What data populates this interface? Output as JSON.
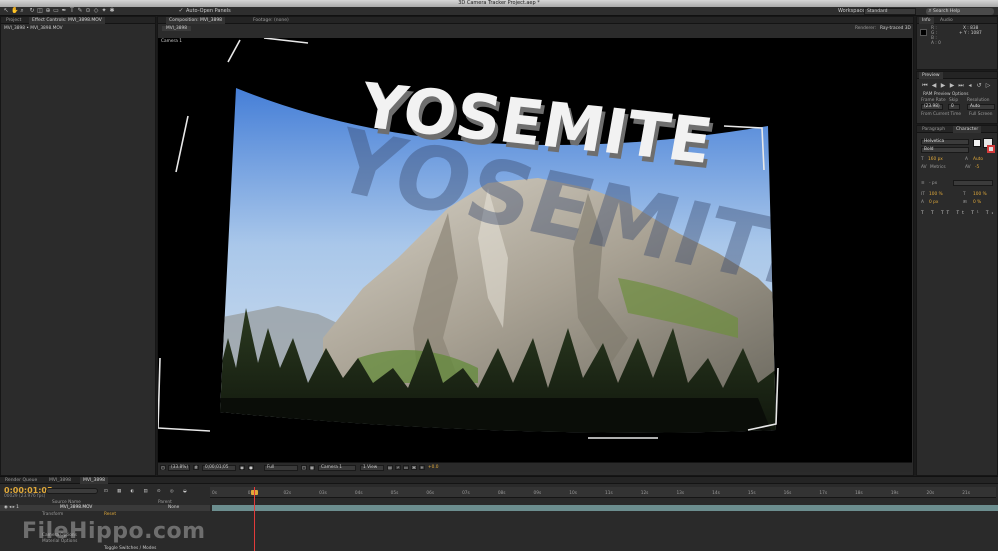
{
  "window": {
    "title": "3D Camera Tracker Project.aep *"
  },
  "toolbar": {
    "auto_open_label": "Auto-Open Panels",
    "workspace_label": "Workspace:",
    "workspace_value": "Standard",
    "search_placeholder": "Search Help"
  },
  "left_panel": {
    "tabs": [
      "Project",
      "Effect Controls: MVI_3898.MOV"
    ],
    "path_label": "MVI_3898 • MVI_3898.MOV"
  },
  "comp_panel": {
    "tabs": [
      "Composition: MVI_3898",
      "Footage: (none)"
    ],
    "comp_tab": "MVI_3898",
    "renderer_label": "Renderer:",
    "renderer_value": "Ray-traced 3D",
    "camera_label": "Camera 1"
  },
  "scene": {
    "title_text": "YOSEMITE",
    "reflection_text": "YOSEMITE"
  },
  "viewer_bar": {
    "zoom": "(33.8%)",
    "timecode": "0;00;01;05",
    "resolution": "Full",
    "camera": "Camera 1",
    "view": "1 View",
    "exposure": "+0.0"
  },
  "info_panel": {
    "tabs": [
      "Info",
      "Audio"
    ],
    "rows": [
      "R :",
      "G :",
      "B :",
      "A : 0"
    ],
    "coords": [
      "X : 838",
      "+ Y : 1087"
    ]
  },
  "preview_panel": {
    "tab": "Preview",
    "ram_label": "RAM Preview Options",
    "frame_rate_label": "Frame Rate",
    "skip_label": "Skip",
    "resolution_label": "Resolution",
    "frame_rate_value": "(23.98)",
    "skip_value": "0",
    "resolution_value": "Auto",
    "from_current_label": "From Current Time",
    "full_screen_label": "Full Screen"
  },
  "character_panel": {
    "tabs": [
      "Paragraph",
      "Character"
    ],
    "font": "Helvetica",
    "style": "Bold",
    "size": "160 px",
    "leading": "Auto",
    "kerning": "Metrics",
    "tracking": "-5",
    "stroke": "- px",
    "vscale": "100 %",
    "hscale": "100 %",
    "baseline": "0 px",
    "tsume": "0 %"
  },
  "timeline": {
    "tabs": [
      "Render Queue",
      "MVI_3898",
      "MVI_3898"
    ],
    "timecode": "0:00:01:05",
    "frame_info": "00029 (23.976 fps)",
    "col_source": "Source Name",
    "col_parent": "Parent",
    "layer_name": "MVI_3898.MOV",
    "parent_value": "None",
    "props": [
      "Transform",
      "Camera Options",
      "Material Options"
    ],
    "reset_label": "Reset",
    "toggle_label": "Toggle Switches / Modes",
    "ruler": [
      "0s",
      "01s",
      "02s",
      "03s",
      "04s",
      "05s",
      "06s",
      "07s",
      "08s",
      "09s",
      "10s",
      "11s",
      "12s",
      "13s",
      "14s",
      "15s",
      "16s",
      "17s",
      "18s",
      "19s",
      "20s",
      "21s"
    ]
  },
  "watermark": "FileHippo.com",
  "colors": {
    "accent": "#e0a93a",
    "playhead": "#e23b3b",
    "layer_bar": "#6c8e8f",
    "track_line": "#e8e8e8"
  }
}
